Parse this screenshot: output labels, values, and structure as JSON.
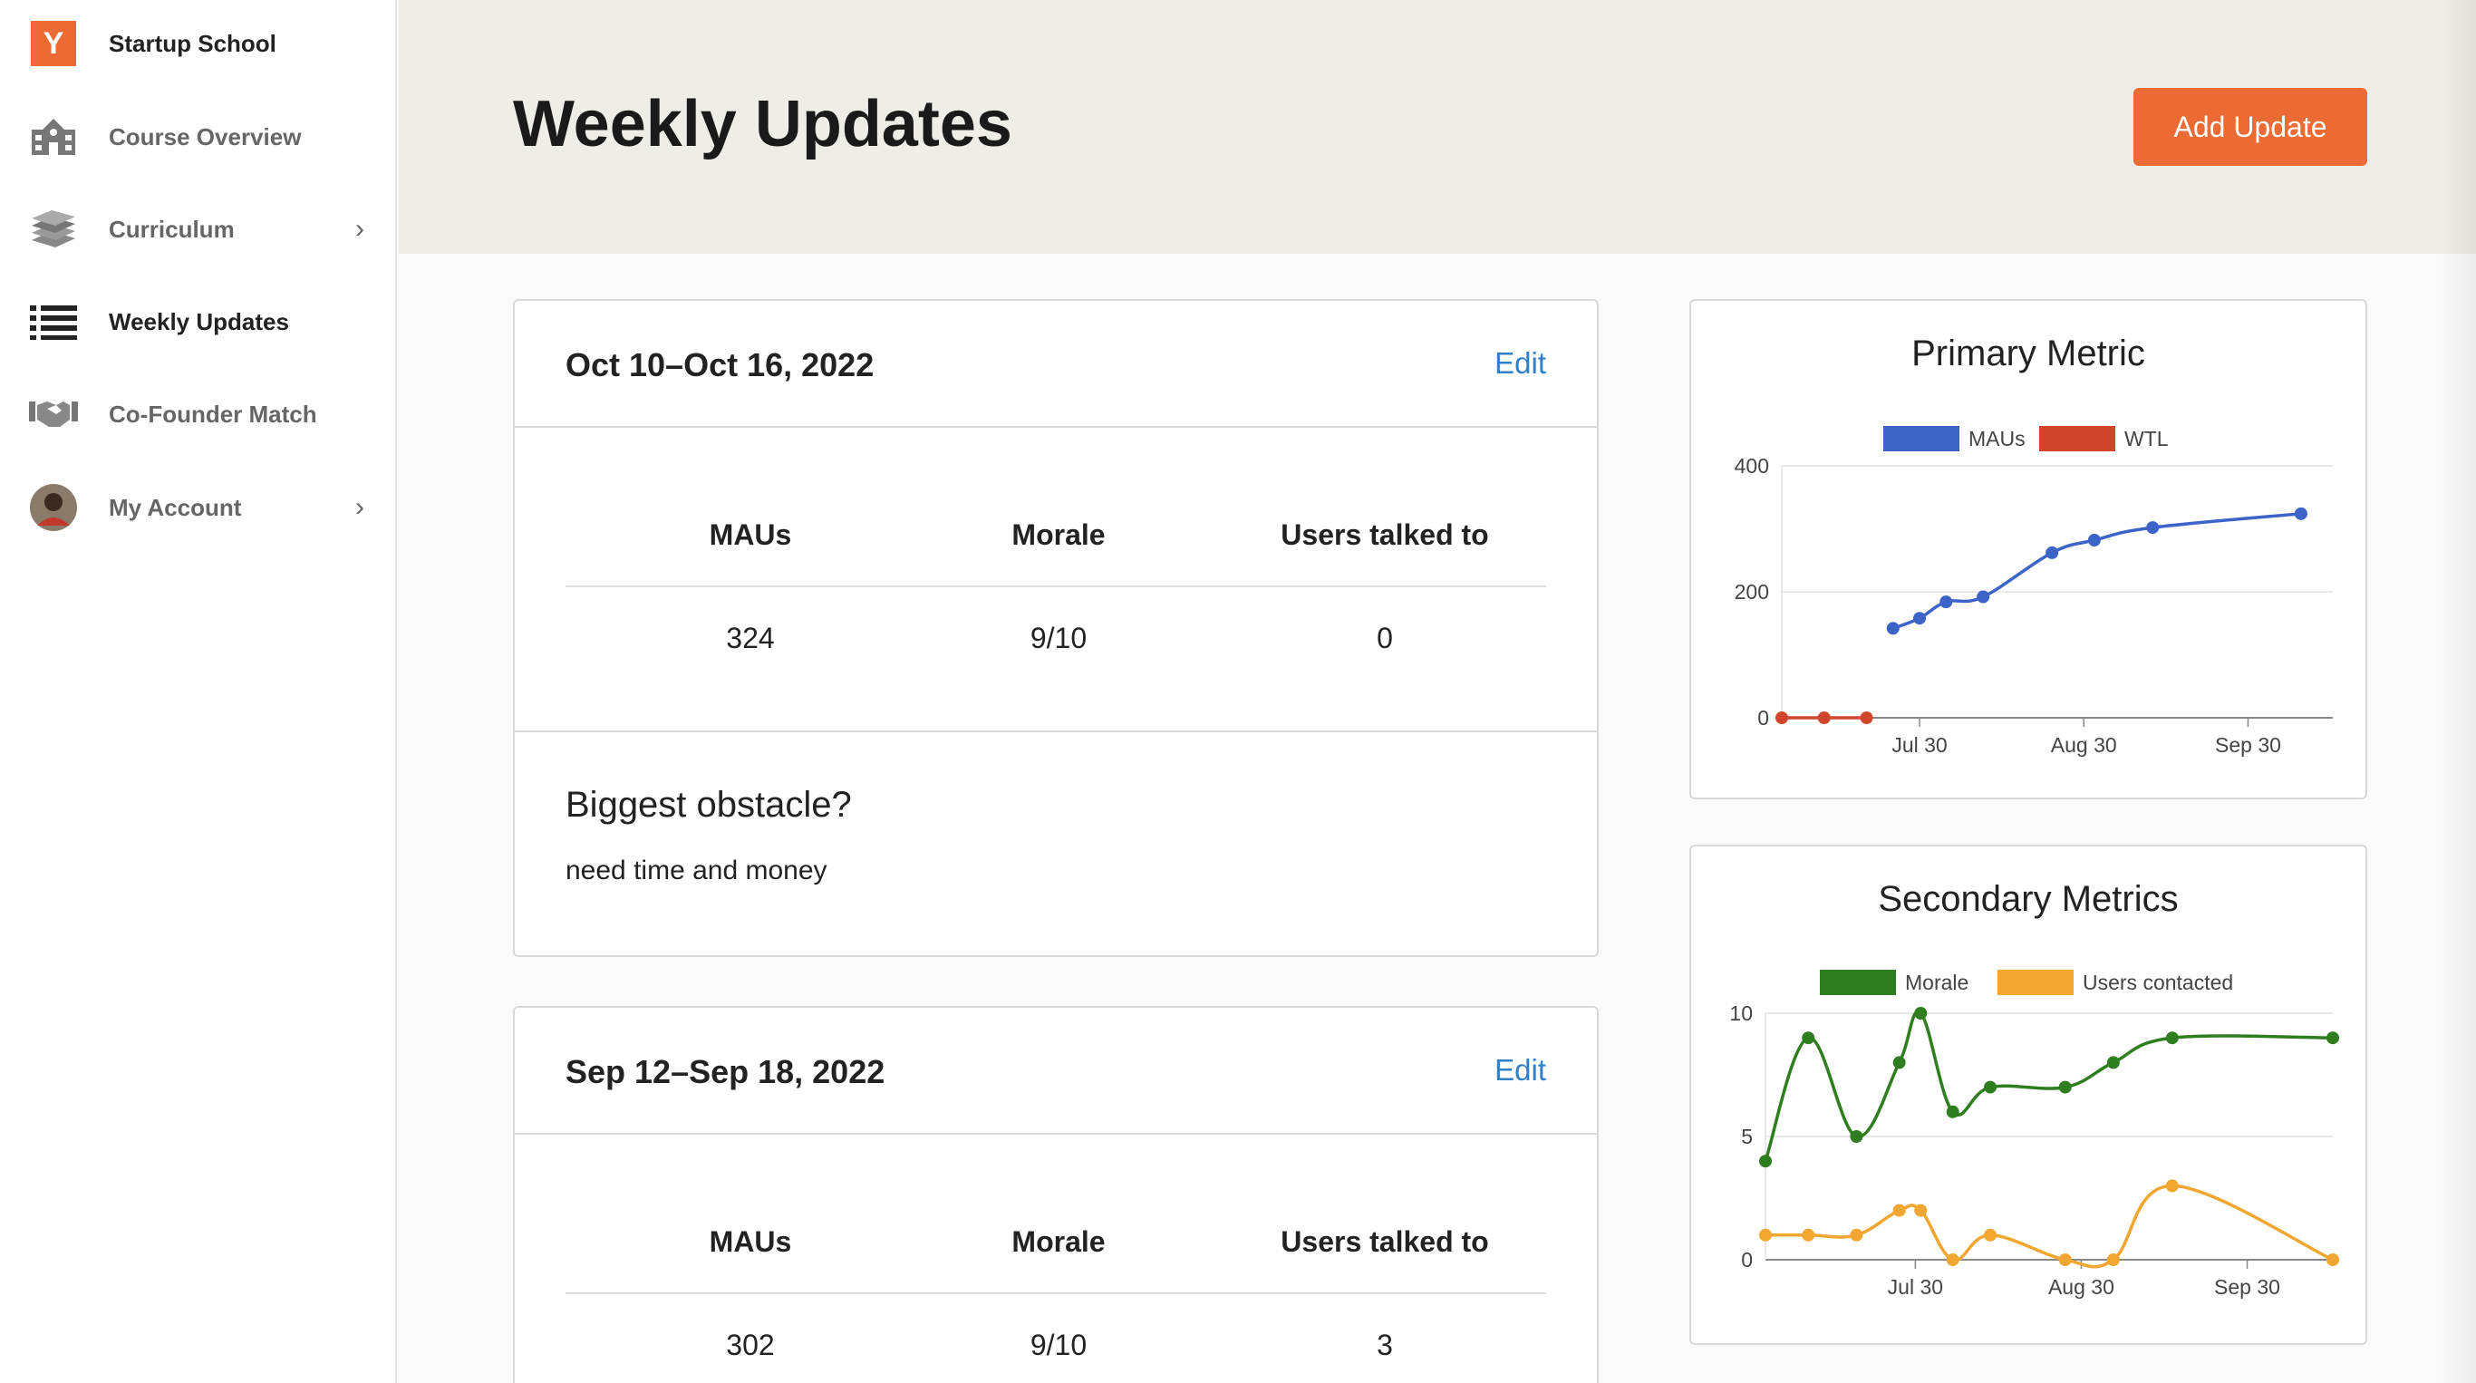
{
  "sidebar": {
    "brand": {
      "logo": "Y",
      "label": "Startup School",
      "color": "#ec6b35"
    },
    "items": [
      {
        "label": "Course Overview",
        "icon": "school-building-icon",
        "chevron": false
      },
      {
        "label": "Curriculum",
        "icon": "books-icon",
        "chevron": true
      },
      {
        "label": "Weekly Updates",
        "icon": "list-icon",
        "chevron": false,
        "active": true
      },
      {
        "label": "Co-Founder Match",
        "icon": "handshake-icon",
        "chevron": false
      },
      {
        "label": "My Account",
        "icon": "avatar",
        "chevron": true
      }
    ]
  },
  "header": {
    "title": "Weekly Updates",
    "add_button": "Add Update"
  },
  "updates": [
    {
      "date": "Oct 10–Oct 16, 2022",
      "edit": "Edit",
      "headers": [
        "MAUs",
        "Morale",
        "Users talked to"
      ],
      "values": [
        "324",
        "9/10",
        "0"
      ],
      "obstacle_q": "Biggest obstacle?",
      "obstacle_a": "need time and money"
    },
    {
      "date": "Sep 12–Sep 18, 2022",
      "edit": "Edit",
      "headers": [
        "MAUs",
        "Morale",
        "Users talked to"
      ],
      "values": [
        "302",
        "9/10",
        "3"
      ]
    }
  ],
  "colors": {
    "accent": "#ec6b35",
    "link": "#2f7fc9",
    "maus": "#3b63c8",
    "wtl": "#d0452c",
    "morale": "#2e7d1e",
    "users_contacted": "#f0a630"
  },
  "chart_data": [
    {
      "type": "line",
      "title": "Primary Metric",
      "legend_position": "top",
      "x_tick_labels": [
        "Jul 30",
        "Aug 30",
        "Sep 30"
      ],
      "y_ticks": [
        0,
        200,
        400
      ],
      "ylim": [
        0,
        400
      ],
      "xlim": [
        "2022-07-04",
        "2022-10-16"
      ],
      "grid": true,
      "series": [
        {
          "name": "MAUs",
          "color": "#3b63c8",
          "x": [
            "2022-07-25",
            "2022-07-30",
            "2022-08-04",
            "2022-08-11",
            "2022-08-24",
            "2022-09-01",
            "2022-09-12",
            "2022-10-10"
          ],
          "values": [
            142,
            158,
            184,
            192,
            262,
            282,
            302,
            324
          ]
        },
        {
          "name": "WTL",
          "color": "#d0452c",
          "x": [
            "2022-07-04",
            "2022-07-12",
            "2022-07-20"
          ],
          "values": [
            0,
            0,
            0
          ]
        }
      ]
    },
    {
      "type": "line",
      "title": "Secondary Metrics",
      "legend_position": "top",
      "x_tick_labels": [
        "Jul 30",
        "Aug 30",
        "Sep 30"
      ],
      "y_ticks": [
        0,
        5,
        10
      ],
      "ylim": [
        0,
        10
      ],
      "xlim": [
        "2022-07-02",
        "2022-10-16"
      ],
      "grid": true,
      "series": [
        {
          "name": "Morale",
          "color": "#2e7d1e",
          "x": [
            "2022-07-02",
            "2022-07-10",
            "2022-07-19",
            "2022-07-27",
            "2022-07-31",
            "2022-08-06",
            "2022-08-13",
            "2022-08-27",
            "2022-09-05",
            "2022-09-16",
            "2022-10-16"
          ],
          "values": [
            4,
            9,
            5,
            8,
            10,
            6,
            7,
            7,
            8,
            9,
            9
          ]
        },
        {
          "name": "Users contacted",
          "color": "#f0a630",
          "x": [
            "2022-07-02",
            "2022-07-10",
            "2022-07-19",
            "2022-07-27",
            "2022-07-31",
            "2022-08-06",
            "2022-08-13",
            "2022-08-27",
            "2022-09-05",
            "2022-09-16",
            "2022-10-16"
          ],
          "values": [
            1,
            1,
            1,
            2,
            2,
            0,
            1,
            0,
            0,
            3,
            0
          ]
        }
      ]
    }
  ]
}
